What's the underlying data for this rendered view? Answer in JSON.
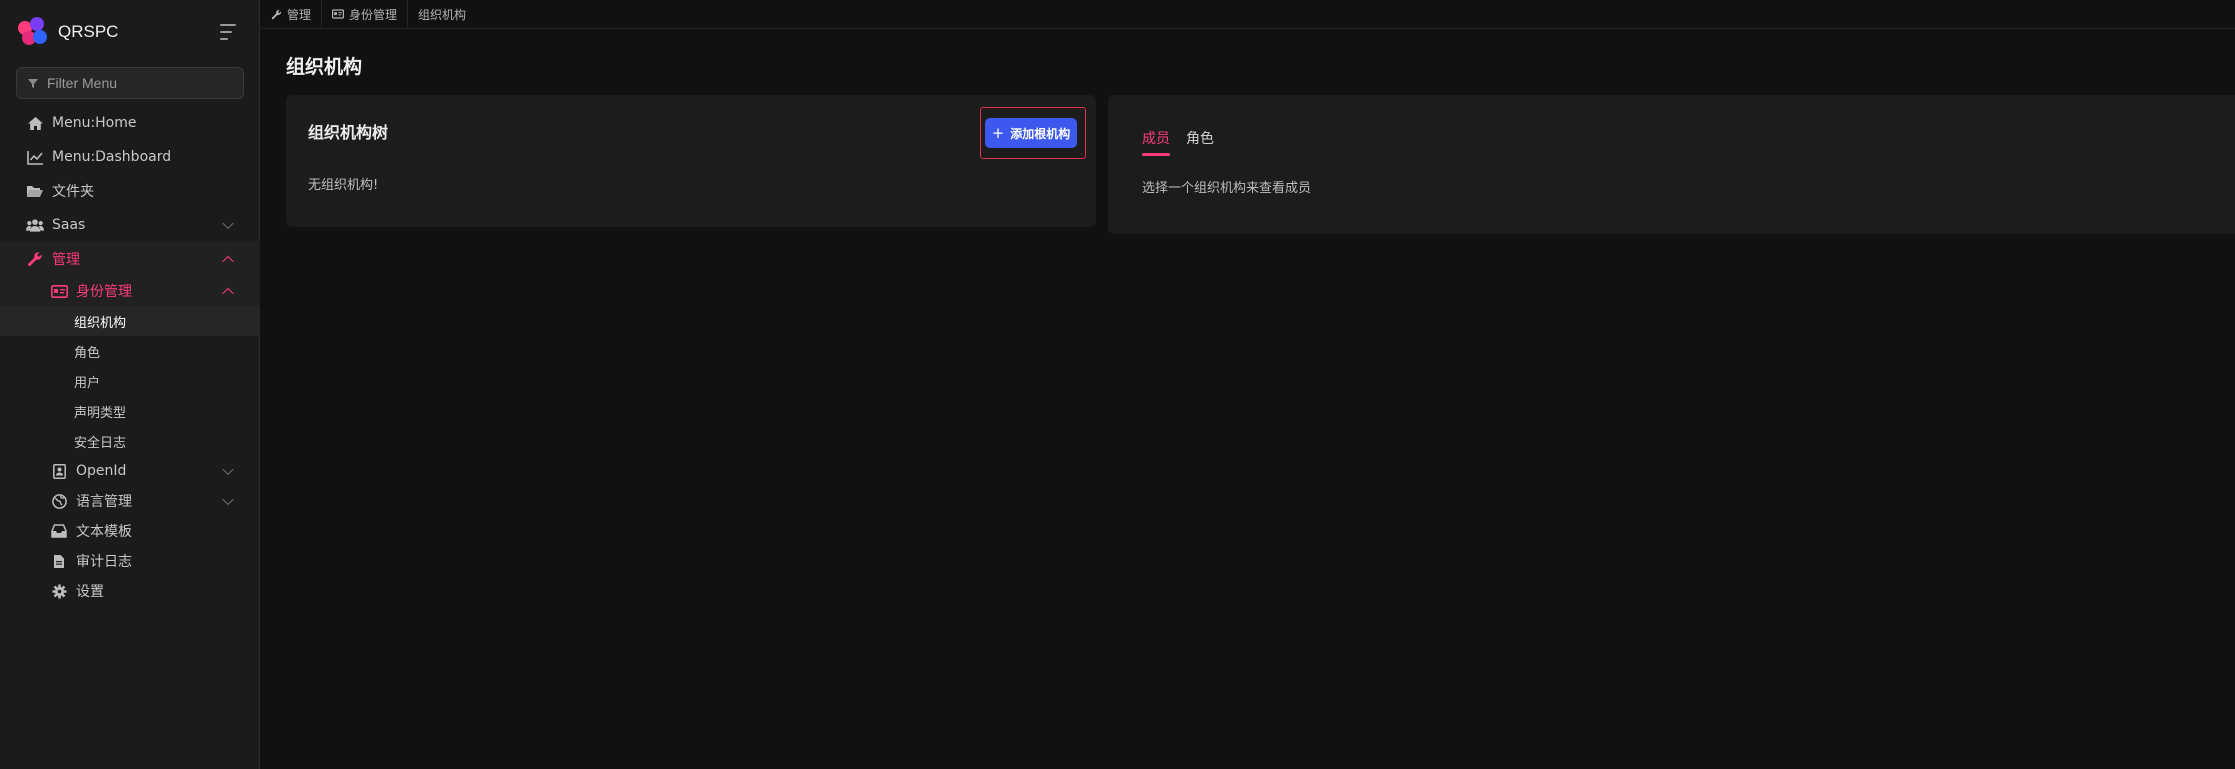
{
  "brand": {
    "title": "QRSPC"
  },
  "sidebar": {
    "filter_placeholder": "Filter Menu",
    "items": [
      {
        "label": "Menu:Home",
        "icon": "home-icon"
      },
      {
        "label": "Menu:Dashboard",
        "icon": "chart-line-icon"
      },
      {
        "label": "文件夹",
        "icon": "folder-open-icon"
      },
      {
        "label": "Saas",
        "icon": "users-icon"
      },
      {
        "label": "管理",
        "icon": "wrench-icon"
      },
      {
        "label": "身份管理",
        "icon": "id-card-icon"
      },
      {
        "label": "组织机构"
      },
      {
        "label": "角色"
      },
      {
        "label": "用户"
      },
      {
        "label": "声明类型"
      },
      {
        "label": "安全日志"
      },
      {
        "label": "OpenId",
        "icon": "openid-icon"
      },
      {
        "label": "语言管理",
        "icon": "globe-icon"
      },
      {
        "label": "文本模板",
        "icon": "inbox-icon"
      },
      {
        "label": "审计日志",
        "icon": "file-icon"
      },
      {
        "label": "设置",
        "icon": "gear-icon"
      }
    ]
  },
  "breadcrumb": [
    "管理",
    "身份管理",
    "组织机构"
  ],
  "page": {
    "title": "组织机构"
  },
  "tree_card": {
    "title": "组织机构树",
    "add_button": "添加根机构",
    "empty_text": "无组织机构!"
  },
  "members_card": {
    "tabs": [
      "成员",
      "角色"
    ],
    "hint": "选择一个组织机构来查看成员"
  },
  "colors": {
    "accent": "#ff3b7a",
    "primary_button": "#3d58ee"
  }
}
